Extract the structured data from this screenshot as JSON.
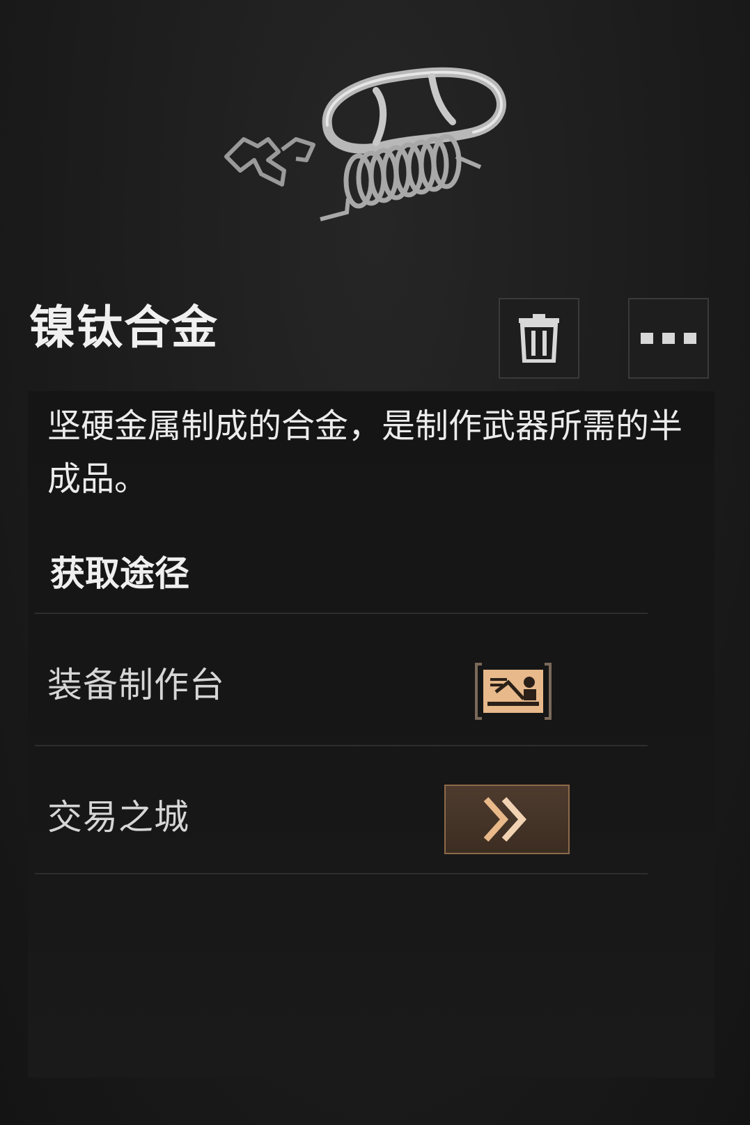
{
  "item": {
    "name": "镍钛合金",
    "description": "坚硬金属制成的合金，是制作武器所需的半成品。"
  },
  "actions": {
    "delete_icon": "trash-icon",
    "more_icon": "more-dots-icon"
  },
  "sources": {
    "heading": "获取途径",
    "items": [
      {
        "label": "装备制作台",
        "icon": "workbench-icon"
      },
      {
        "label": "交易之城",
        "icon": "double-chevron-right-icon"
      }
    ]
  },
  "colors": {
    "accent": "#e9b98a",
    "button_bg": "#4a392c",
    "button_border": "#8e6a49"
  }
}
